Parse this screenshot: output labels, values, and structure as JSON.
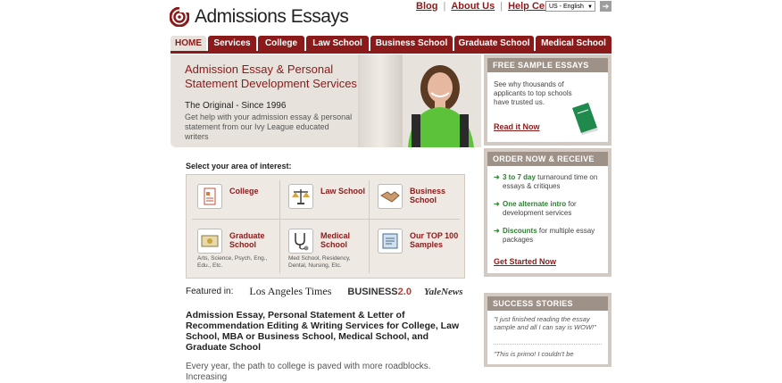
{
  "brand": {
    "name": "Admissions Essays"
  },
  "top_links": [
    "Blog",
    "About Us",
    "Help Center"
  ],
  "language": {
    "selected": "US - English",
    "go_glyph": "➔"
  },
  "nav": {
    "tabs": [
      "HOME",
      "Services",
      "College",
      "Law School",
      "Business School",
      "Graduate School",
      "Medical School"
    ]
  },
  "hero": {
    "title": "Admission Essay & Personal Statement Development Services",
    "subtitle": "The Original - Since 1996",
    "description": "Get help with your admission essay & personal statement from our Ivy League educated writers"
  },
  "free_sample": {
    "header": "FREE SAMPLE ESSAYS",
    "text": "See why thousands of applicants to top schools have trusted us.",
    "link": "Read it Now"
  },
  "order": {
    "header": "ORDER NOW & RECEIVE",
    "items": [
      {
        "bold": "3 to 7 day",
        "rest": " turnaround time on essays & critiques"
      },
      {
        "bold": "One alternate intro",
        "rest": " for development services"
      },
      {
        "bold": "Discounts",
        "rest": " for multiple essay packages"
      }
    ],
    "link": "Get Started Now"
  },
  "success": {
    "header": "SUCCESS STORIES",
    "quotes": [
      "\"I just finished reading the essay sample and all I can say is WOW!\"",
      "\"This is primo! I couldn't be"
    ]
  },
  "interest": {
    "heading": "Select your area of interest:",
    "cells": [
      {
        "label": "College",
        "note": ""
      },
      {
        "label": "Law School",
        "note": ""
      },
      {
        "label": "Business School",
        "note": ""
      },
      {
        "label": "Graduate School",
        "note": "Arts, Science, Psych, Eng., Edu., Etc."
      },
      {
        "label": "Medical School",
        "note": "Med School, Residency, Dental, Nursing, Etc."
      },
      {
        "label": "Our TOP 100 Samples",
        "note": ""
      }
    ]
  },
  "featured": {
    "label": "Featured in:",
    "lat": "Los Angeles Times",
    "business_a": "BUSINESS",
    "business_b": "2.0",
    "yale": "YaleNews"
  },
  "main": {
    "heading": "Admission Essay, Personal Statement & Letter of Recommendation Editing & Writing Services for College, Law School, MBA or Business School, Medical School, and Graduate School",
    "body": "Every year, the path to college is paved with more roadblocks. Increasing"
  },
  "colors": {
    "brand": "#8b1a1a",
    "panel": "#e8e2dc",
    "accent_green": "#2e7d32"
  }
}
